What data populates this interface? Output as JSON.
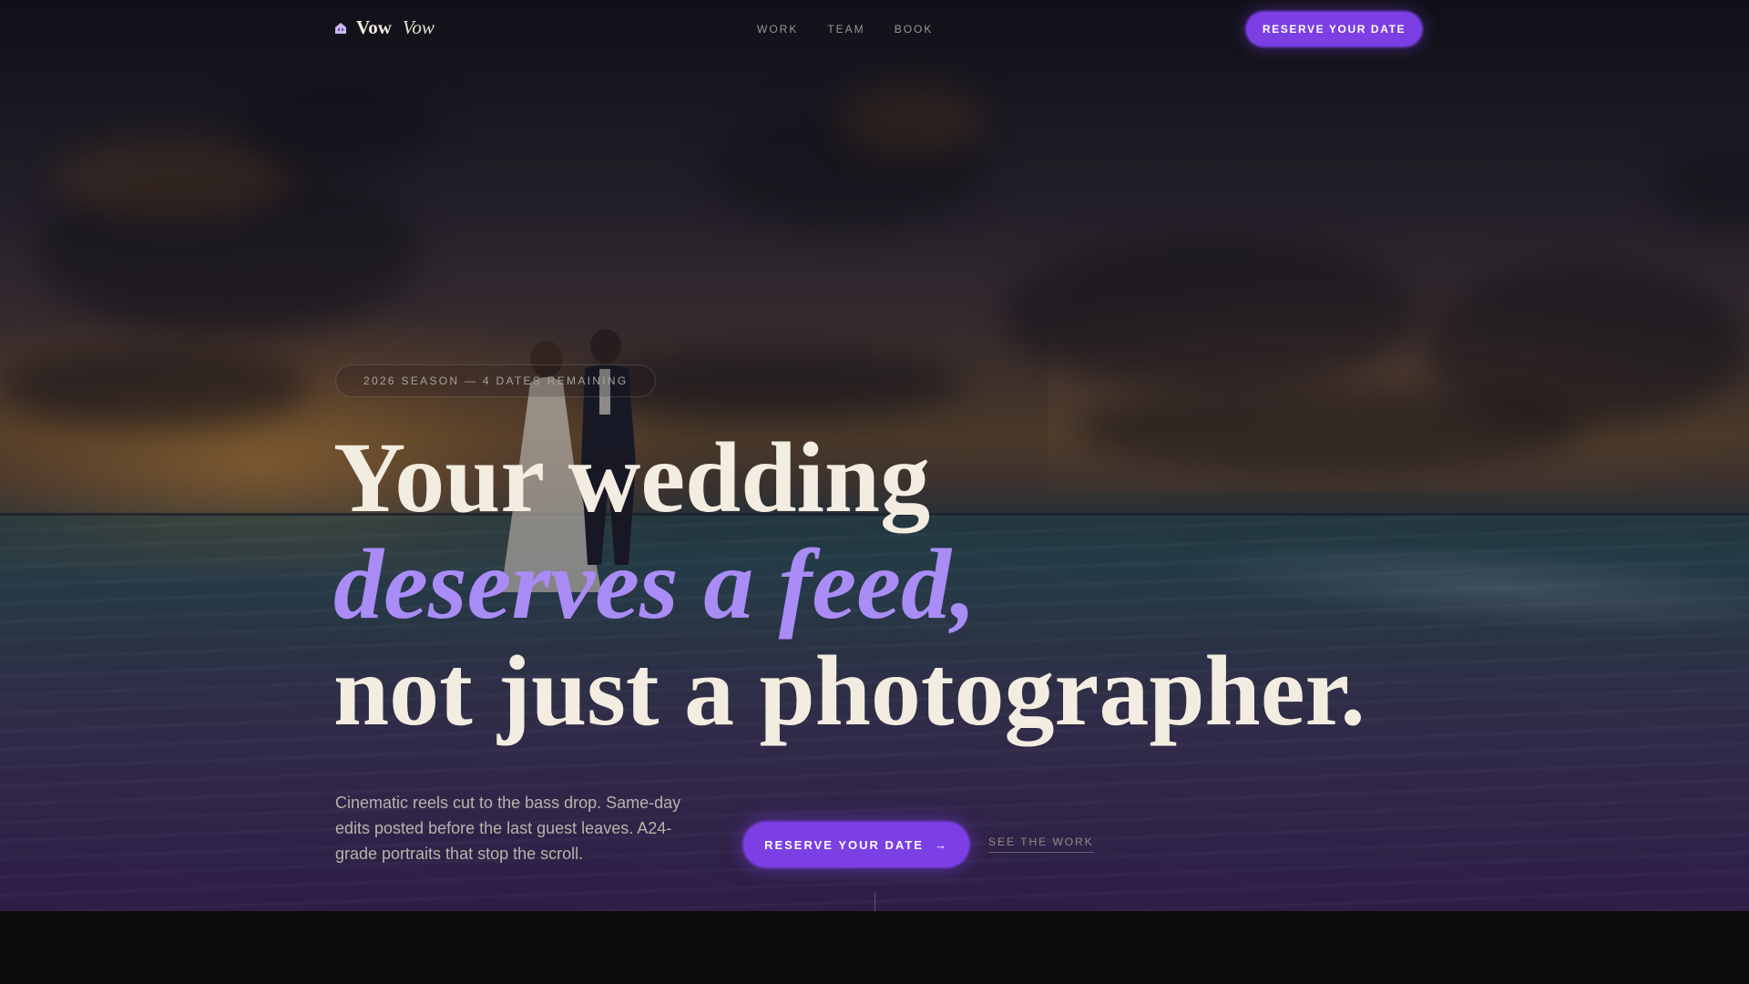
{
  "brand": {
    "name": "Vow",
    "name_italic": "Vow",
    "icon": "logo-house-icon"
  },
  "nav": {
    "items": [
      "WORK",
      "TEAM",
      "BOOK"
    ],
    "cta_label": "RESERVE YOUR DATE"
  },
  "hero": {
    "badge": "2026 SEASON — 4 DATES REMAINING",
    "headline": {
      "line1": "Your wedding",
      "line2": "deserves a feed,",
      "line3": "not just a photographer."
    },
    "description": "Cinematic reels cut to the bass drop. Same-day edits posted before the last guest leaves. A24-grade portraits that stop the scroll.",
    "cta_label": "RESERVE YOUR DATE",
    "cta_arrow": "→",
    "secondary_link": "SEE THE WORK",
    "background": "wedding-couple-beach-sunset-photo"
  },
  "colors": {
    "accent": "#7b3fe4",
    "accent_text": "#a98cf5",
    "text": "#f3ece0",
    "muted": "#9a968f",
    "page_bg": "#0d0c0f"
  }
}
